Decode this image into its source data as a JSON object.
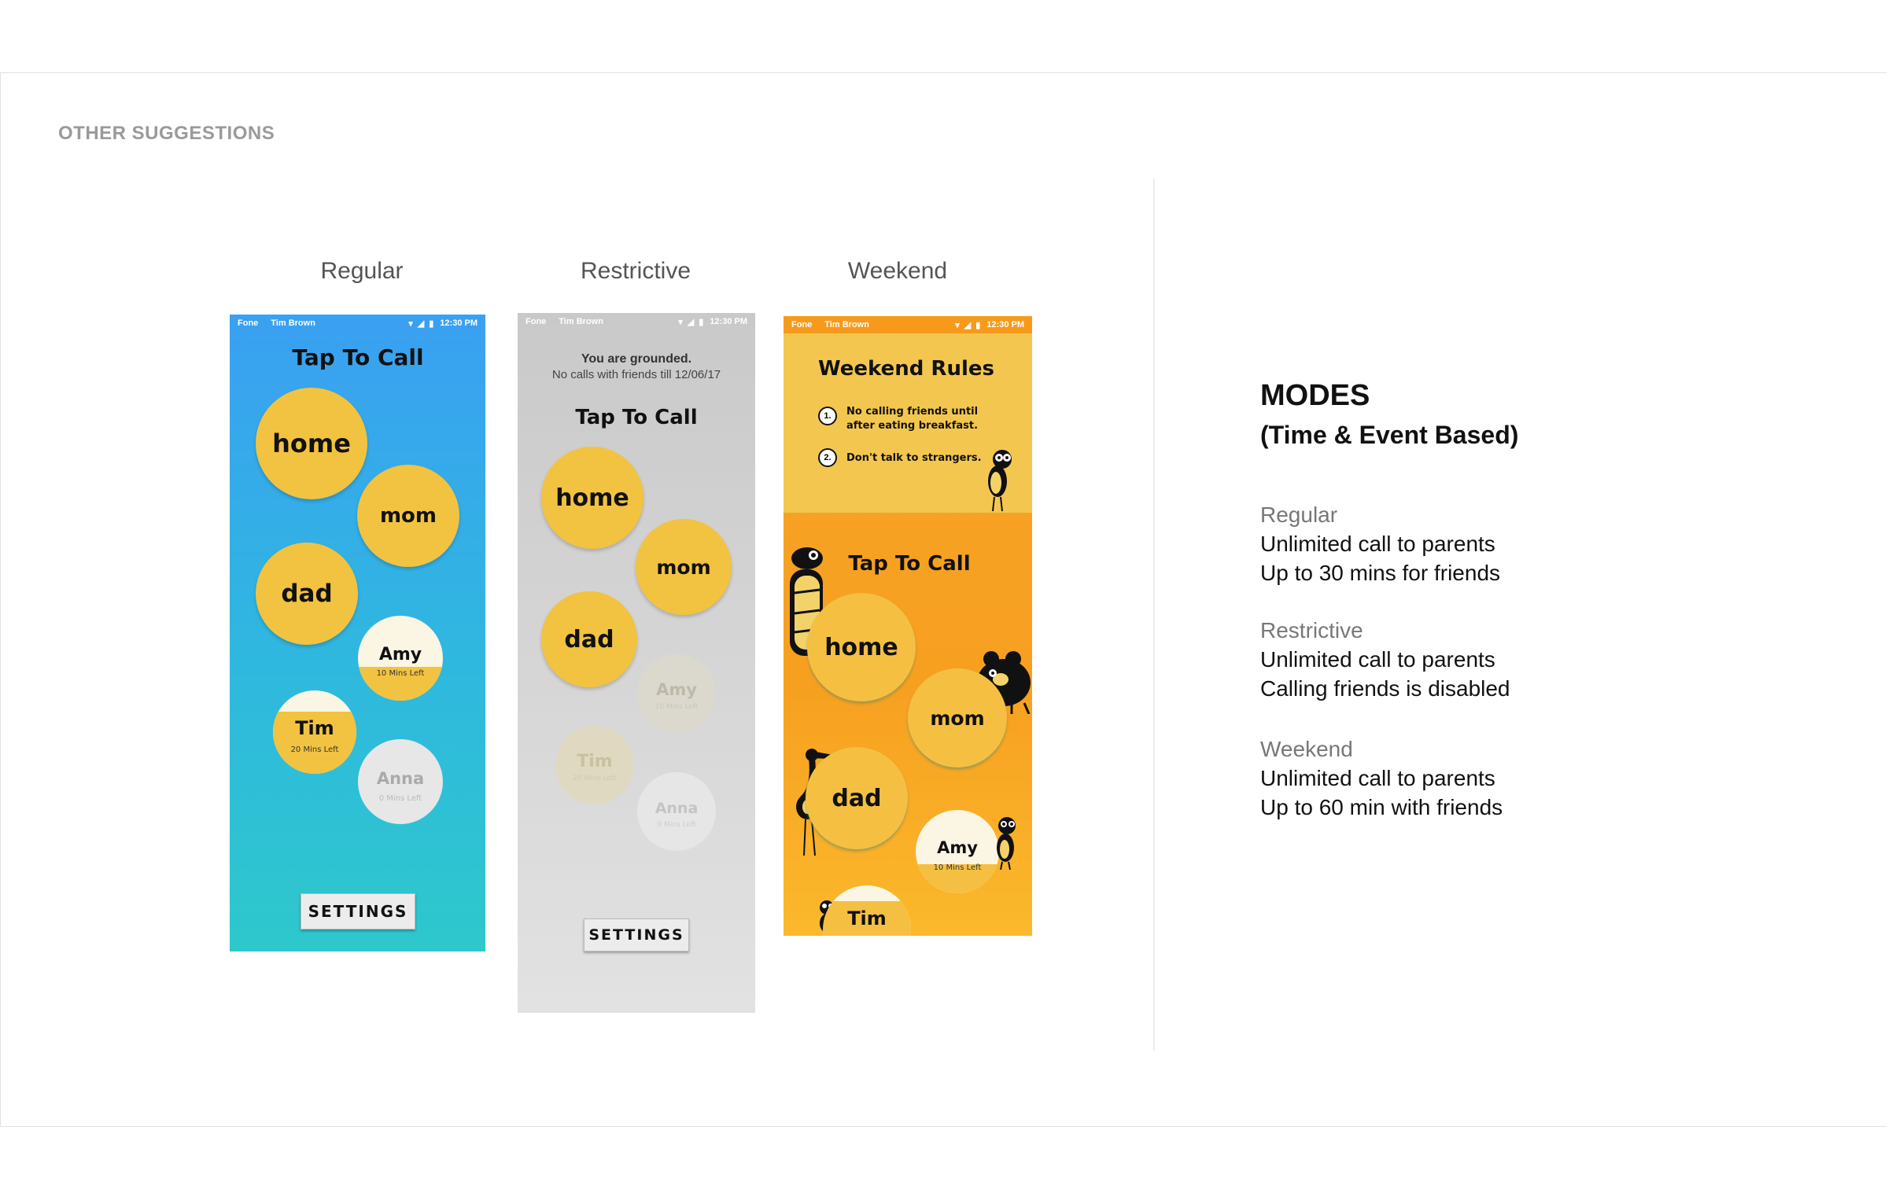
{
  "section_label": "OTHER SUGGESTIONS",
  "modes": [
    "Regular",
    "Restrictive",
    "Weekend"
  ],
  "status_bar": {
    "app": "Fone",
    "user": "Tim Brown",
    "time": "12:30 PM"
  },
  "regular": {
    "title": "Tap To Call",
    "contacts": [
      {
        "name": "home"
      },
      {
        "name": "mom"
      },
      {
        "name": "dad"
      },
      {
        "name": "Amy",
        "sub": "10 Mins Left",
        "remaining": 0.4
      },
      {
        "name": "Tim",
        "sub": "20 Mins Left",
        "remaining": 0.75
      },
      {
        "name": "Anna",
        "sub": "0 Mins Left",
        "remaining": 0
      }
    ],
    "settings": "SETTINGS"
  },
  "restrictive": {
    "notice_line1": "You are grounded.",
    "notice_line2": "No calls with friends till 12/06/17",
    "title": "Tap To Call",
    "contacts": [
      {
        "name": "home"
      },
      {
        "name": "mom"
      },
      {
        "name": "dad"
      },
      {
        "name": "Amy",
        "sub": "10 Mins Left"
      },
      {
        "name": "Tim",
        "sub": "20 Mins Left"
      },
      {
        "name": "Anna",
        "sub": "0 Mins Left"
      }
    ],
    "settings": "SETTINGS"
  },
  "weekend": {
    "rules_title": "Weekend Rules",
    "rules": [
      {
        "num": "1.",
        "line1": "No calling friends until",
        "line2": "after eating breakfast."
      },
      {
        "num": "2.",
        "line1": "Don't talk to strangers.",
        "line2": ""
      }
    ],
    "title": "Tap To Call",
    "contacts": [
      {
        "name": "home"
      },
      {
        "name": "mom"
      },
      {
        "name": "dad"
      },
      {
        "name": "Amy",
        "sub": "10 Mins Left",
        "remaining": 0.35
      },
      {
        "name": "Tim"
      }
    ]
  },
  "info": {
    "heading": "MODES",
    "subheading": "(Time & Event Based)",
    "descriptions": [
      {
        "title": "Regular",
        "line1": "Unlimited call to parents",
        "line2": "Up to 30 mins for friends"
      },
      {
        "title": "Restrictive",
        "line1": "Unlimited call to parents",
        "line2": "Calling friends is disabled"
      },
      {
        "title": "Weekend",
        "line1": "Unlimited call to parents",
        "line2": "Up to 60 min with friends"
      }
    ]
  },
  "colors": {
    "regular_gradient": [
      "#3aa0f2",
      "#2ec8cc"
    ],
    "restrictive_bg": "#cfcfcf",
    "weekend_top": "#f5c64c",
    "weekend_bottom": "#f7a020",
    "contact_yellow": "#f2c340"
  }
}
